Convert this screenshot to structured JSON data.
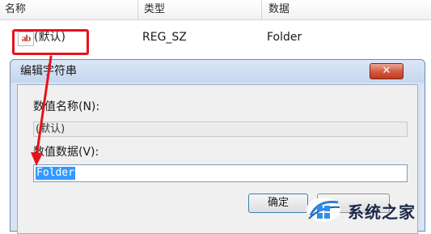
{
  "list": {
    "columns": [
      "名称",
      "类型",
      "数据"
    ],
    "row": {
      "name": "(默认)",
      "type": "REG_SZ",
      "data": "Folder"
    }
  },
  "dialog": {
    "title": "编辑字符串",
    "close_label": "✕",
    "value_name_label": "数值名称(N):",
    "value_name": "(默认)",
    "value_data_label": "数值数据(V):",
    "value_data": "Folder",
    "ok_label": "确定"
  },
  "watermark": {
    "text": "系统之家"
  },
  "icons": {
    "string_value": "ab-string-icon",
    "watermark": "windows-logo-icon"
  },
  "colors": {
    "highlight": "#e8121a",
    "selection": "#3399ff",
    "close": "#c0391f"
  }
}
